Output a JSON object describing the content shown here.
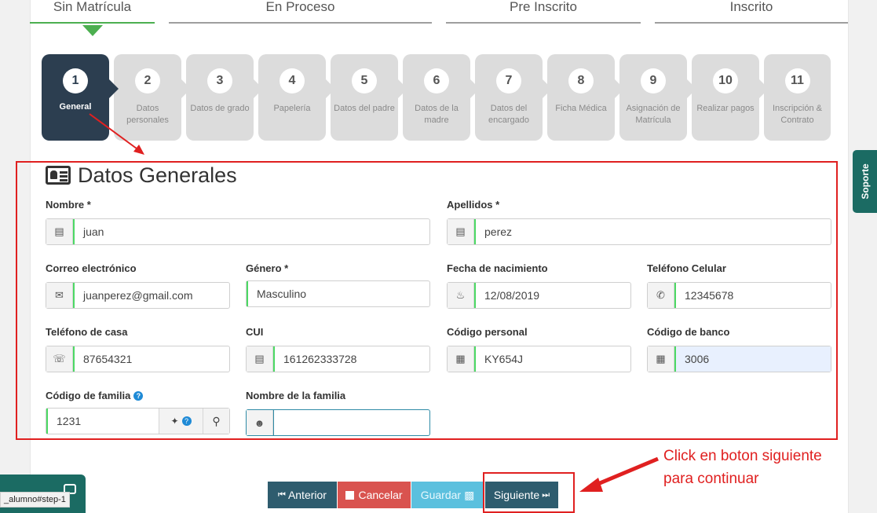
{
  "status_tabs": [
    "Sin Matrícula",
    "En Proceso",
    "Pre Inscrito",
    "Inscrito"
  ],
  "steps": [
    {
      "num": "1",
      "label": "General"
    },
    {
      "num": "2",
      "label": "Datos personales"
    },
    {
      "num": "3",
      "label": "Datos de grado"
    },
    {
      "num": "4",
      "label": "Papelería"
    },
    {
      "num": "5",
      "label": "Datos del padre"
    },
    {
      "num": "6",
      "label": "Datos de la madre"
    },
    {
      "num": "7",
      "label": "Datos del encargado"
    },
    {
      "num": "8",
      "label": "Ficha Médica"
    },
    {
      "num": "9",
      "label": "Asignación de Matrícula"
    },
    {
      "num": "10",
      "label": "Realizar pagos"
    },
    {
      "num": "11",
      "label": "Inscripción & Contrato"
    }
  ],
  "form": {
    "title": "Datos Generales",
    "nombre_label": "Nombre *",
    "nombre": "juan",
    "apellidos_label": "Apellidos *",
    "apellidos": "perez",
    "correo_label": "Correo electrónico",
    "correo": "juanperez@gmail.com",
    "genero_label": "Género *",
    "genero": "Masculino",
    "fecha_label": "Fecha de nacimiento",
    "fecha": "12/08/2019",
    "celular_label": "Teléfono Celular",
    "celular": "12345678",
    "casa_label": "Teléfono de casa",
    "casa": "87654321",
    "cui_label": "CUI",
    "cui": "161262333728",
    "codigo_personal_label": "Código personal",
    "codigo_personal": "KY654J",
    "codigo_banco_label": "Código de banco",
    "codigo_banco": "3006",
    "codigo_familia_label": "Código de familia",
    "codigo_familia": "1231",
    "nombre_familia_label": "Nombre de la familia",
    "nombre_familia": ""
  },
  "buttons": {
    "anterior": "Anterior",
    "cancelar": "Cancelar",
    "guardar": "Guardar",
    "siguiente": "Siguiente"
  },
  "annotation": {
    "line1": "Click en boton siguiente",
    "line2": "para continuar"
  },
  "soporte": "Soporte",
  "status_url": "_alumno#step-1",
  "colors": {
    "active_step": "#2c3e50",
    "inactive_step": "#dcdcdc",
    "accent_green": "#4caf50",
    "annotation_red": "#e02020",
    "btn_primary": "#2e5c6e",
    "btn_danger": "#d9534f",
    "btn_info": "#5bc0de"
  }
}
